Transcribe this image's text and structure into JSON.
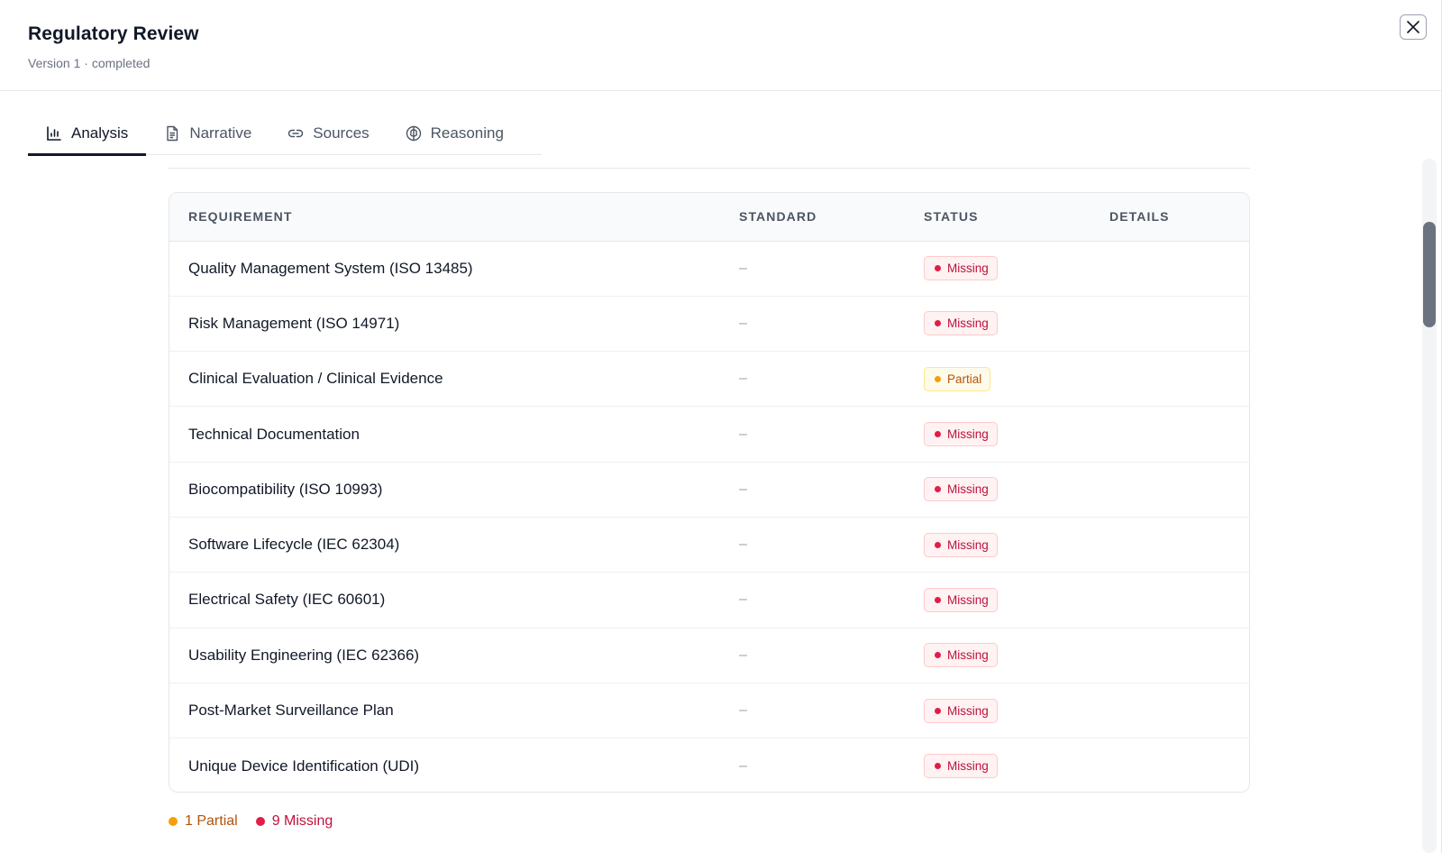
{
  "header": {
    "title": "Regulatory Review",
    "subtitle": "Version 1 · completed",
    "close_icon": "close-icon"
  },
  "tabs": [
    {
      "label": "Analysis",
      "icon": "bar-chart-icon",
      "active": true
    },
    {
      "label": "Narrative",
      "icon": "document-icon",
      "active": false
    },
    {
      "label": "Sources",
      "icon": "link-icon",
      "active": false
    },
    {
      "label": "Reasoning",
      "icon": "brain-icon",
      "active": false
    }
  ],
  "table": {
    "columns": [
      "REQUIREMENT",
      "STANDARD",
      "STATUS",
      "DETAILS"
    ],
    "rows": [
      {
        "requirement": "Quality Management System (ISO 13485)",
        "standard": "–",
        "status": "Missing",
        "details": ""
      },
      {
        "requirement": "Risk Management (ISO 14971)",
        "standard": "–",
        "status": "Missing",
        "details": ""
      },
      {
        "requirement": "Clinical Evaluation / Clinical Evidence",
        "standard": "–",
        "status": "Partial",
        "details": ""
      },
      {
        "requirement": "Technical Documentation",
        "standard": "–",
        "status": "Missing",
        "details": ""
      },
      {
        "requirement": "Biocompatibility (ISO 10993)",
        "standard": "–",
        "status": "Missing",
        "details": ""
      },
      {
        "requirement": "Software Lifecycle (IEC 62304)",
        "standard": "–",
        "status": "Missing",
        "details": ""
      },
      {
        "requirement": "Electrical Safety (IEC 60601)",
        "standard": "–",
        "status": "Missing",
        "details": ""
      },
      {
        "requirement": "Usability Engineering (IEC 62366)",
        "standard": "–",
        "status": "Missing",
        "details": ""
      },
      {
        "requirement": "Post-Market Surveillance Plan",
        "standard": "–",
        "status": "Missing",
        "details": ""
      },
      {
        "requirement": "Unique Device Identification (UDI)",
        "standard": "–",
        "status": "Missing",
        "details": ""
      }
    ]
  },
  "summary": {
    "partial": "1 Partial",
    "missing": "9 Missing"
  },
  "colors": {
    "missing": "#e11d48",
    "partial": "#f59e0b",
    "text": "#111827",
    "muted": "#6b7280"
  }
}
